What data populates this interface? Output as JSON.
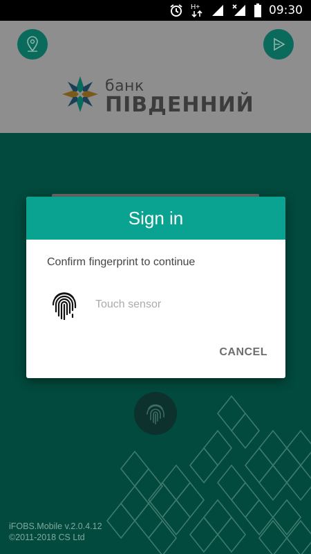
{
  "status_bar": {
    "time": "09:30",
    "network_label": "H+",
    "icons": [
      "alarm-icon",
      "data-arrows-icon",
      "signal-icon",
      "signal-x-icon",
      "battery-icon"
    ]
  },
  "header": {
    "logo_small": "банк",
    "logo_big": "ПІВДЕННИЙ",
    "buttons": [
      "location-icon",
      "play-icon"
    ]
  },
  "dialog": {
    "title": "Sign in",
    "message": "Confirm fingerprint to continue",
    "hint": "Touch sensor",
    "cancel_label": "CANCEL"
  },
  "footer": {
    "version": "iFOBS.Mobile v.2.0.4.12",
    "copyright": "©2011-2018 CS Ltd"
  },
  "colors": {
    "teal_header": "#0aa290",
    "dark_bg": "#024a3d",
    "dimmed_header": "#8e8e8e",
    "button_teal": "#0a6a5b"
  }
}
